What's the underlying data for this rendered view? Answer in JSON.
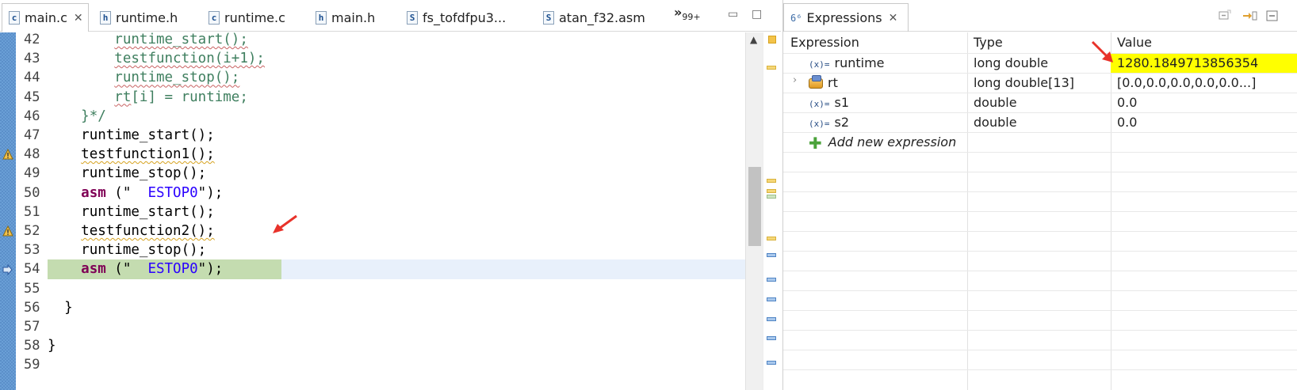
{
  "editor": {
    "tabs": [
      {
        "label": "main.c",
        "icon": "c-file-icon",
        "icon_glyph": "c",
        "active": true
      },
      {
        "label": "runtime.h",
        "icon": "h-file-icon",
        "icon_glyph": "h"
      },
      {
        "label": "runtime.c",
        "icon": "c-file-icon",
        "icon_glyph": "c"
      },
      {
        "label": "main.h",
        "icon": "h-file-icon",
        "icon_glyph": "h"
      },
      {
        "label": "fs_tofdfpu3...",
        "icon": "s-file-icon",
        "icon_glyph": "S"
      },
      {
        "label": "atan_f32.asm",
        "icon": "s-file-icon",
        "icon_glyph": "S"
      }
    ],
    "close_glyph": "✕",
    "more_tabs_glyph": "»",
    "more_tabs_count": "99+",
    "minimize_glyph": "▭",
    "maximize_glyph": "□",
    "lines": [
      {
        "num": "42",
        "indent": "        ",
        "text": "runtime_start();",
        "style": "comment-wavy"
      },
      {
        "num": "43",
        "indent": "        ",
        "text": "testfunction(i+1);",
        "style": "comment-wavy"
      },
      {
        "num": "44",
        "indent": "        ",
        "text": "runtime_stop();",
        "style": "comment-wavy"
      },
      {
        "num": "45",
        "indent": "        ",
        "text": "rt[i] = runtime;",
        "style": "comment-rt"
      },
      {
        "num": "46",
        "indent": "    ",
        "text": "}*/",
        "style": "comment"
      },
      {
        "num": "47",
        "indent": "    ",
        "text": "runtime_start();",
        "style": "plain"
      },
      {
        "num": "48",
        "indent": "    ",
        "text": "testfunction1();",
        "style": "warn",
        "warning": true
      },
      {
        "num": "49",
        "indent": "    ",
        "text": "runtime_stop();",
        "style": "plain"
      },
      {
        "num": "50",
        "indent": "    ",
        "kw": "asm",
        "mid": " (\"  ",
        "str": "ESTOP0",
        "end": "\");",
        "style": "asm"
      },
      {
        "num": "51",
        "indent": "    ",
        "text": "runtime_start();",
        "style": "plain"
      },
      {
        "num": "52",
        "indent": "    ",
        "text": "testfunction2();",
        "style": "warn",
        "warning": true
      },
      {
        "num": "53",
        "indent": "    ",
        "text": "runtime_stop();",
        "style": "plain"
      },
      {
        "num": "54",
        "indent": "    ",
        "kw": "asm",
        "mid": " (\"  ",
        "str": "ESTOP0",
        "end": "\");",
        "style": "asm",
        "current": true
      },
      {
        "num": "55",
        "indent": "",
        "text": "",
        "style": "plain"
      },
      {
        "num": "56",
        "indent": "  ",
        "text": "}",
        "style": "plain"
      },
      {
        "num": "57",
        "indent": "",
        "text": "",
        "style": "plain"
      },
      {
        "num": "58",
        "indent": "",
        "text": "}",
        "style": "plain"
      },
      {
        "num": "59",
        "indent": "",
        "text": "",
        "style": "plain"
      }
    ],
    "scroll_up_glyph": "▲"
  },
  "expressions": {
    "tab_label": "Expressions",
    "tab_icon_glyph": "6⁶",
    "close_glyph": "✕",
    "columns": [
      "Expression",
      "Type",
      "Value"
    ],
    "var_icon_glyph": "(x)=",
    "rows": [
      {
        "name": "runtime",
        "type": "long double",
        "value": "1280.1849713856354",
        "icon": "variable-icon",
        "highlight": true
      },
      {
        "name": "rt",
        "type": "long double[13]",
        "value": "[0.0,0.0,0.0,0.0,0.0...]",
        "icon": "array-icon",
        "expandable": true
      },
      {
        "name": "s1",
        "type": "double",
        "value": "0.0",
        "icon": "variable-icon"
      },
      {
        "name": "s2",
        "type": "double",
        "value": "0.0",
        "icon": "variable-icon"
      }
    ],
    "add_label": "Add new expression",
    "expand_glyph": "›",
    "plus_glyph": "✚"
  },
  "colors": {
    "comment": "#3f7f5f",
    "keyword": "#7f0055",
    "string": "#2a00ff",
    "current_line": "#c4dcb0",
    "value_highlight": "#ffff00",
    "annotation_arrow": "#e8322a"
  }
}
